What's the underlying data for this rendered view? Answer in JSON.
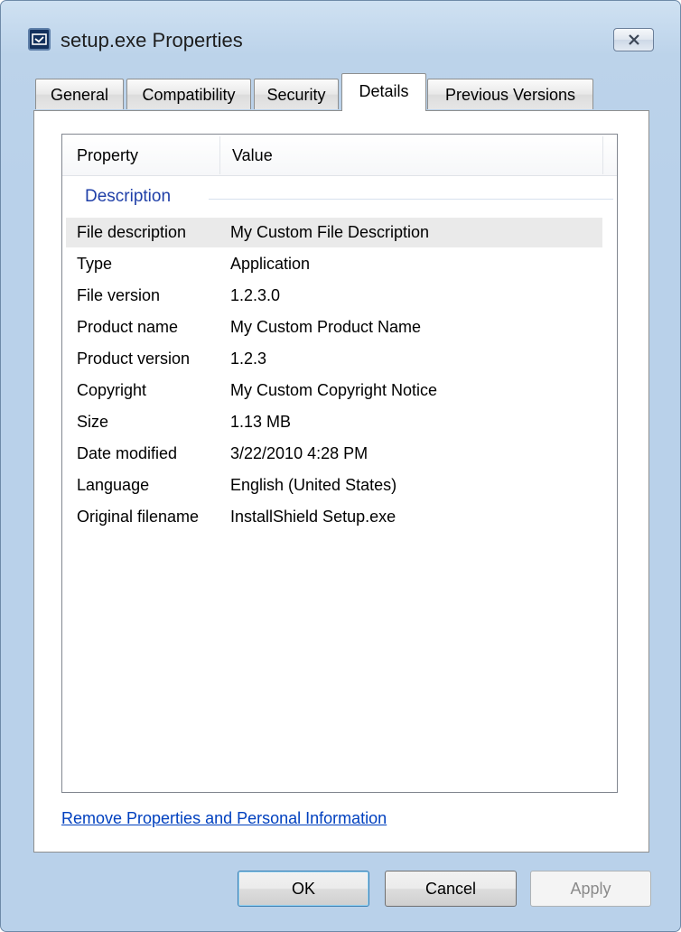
{
  "window": {
    "title": "setup.exe Properties"
  },
  "tabs": [
    {
      "label": "General",
      "active": false
    },
    {
      "label": "Compatibility",
      "active": false
    },
    {
      "label": "Security",
      "active": false
    },
    {
      "label": "Details",
      "active": true
    },
    {
      "label": "Previous Versions",
      "active": false
    }
  ],
  "list": {
    "columns": {
      "property": "Property",
      "value": "Value"
    },
    "group": "Description",
    "rows": [
      {
        "property": "File description",
        "value": "My Custom File Description",
        "selected": true
      },
      {
        "property": "Type",
        "value": "Application"
      },
      {
        "property": "File version",
        "value": "1.2.3.0"
      },
      {
        "property": "Product name",
        "value": "My Custom Product Name"
      },
      {
        "property": "Product version",
        "value": "1.2.3"
      },
      {
        "property": "Copyright",
        "value": "My Custom Copyright Notice"
      },
      {
        "property": "Size",
        "value": "1.13 MB"
      },
      {
        "property": "Date modified",
        "value": "3/22/2010 4:28 PM"
      },
      {
        "property": "Language",
        "value": "English (United States)"
      },
      {
        "property": "Original filename",
        "value": "InstallShield Setup.exe"
      }
    ]
  },
  "link": {
    "remove": "Remove Properties and Personal Information"
  },
  "buttons": {
    "ok": "OK",
    "cancel": "Cancel",
    "apply": "Apply",
    "apply_enabled": false
  },
  "colors": {
    "link": "#0040bf",
    "group_heading": "#1f3fa8",
    "window_frame": "#b9d1ea"
  }
}
